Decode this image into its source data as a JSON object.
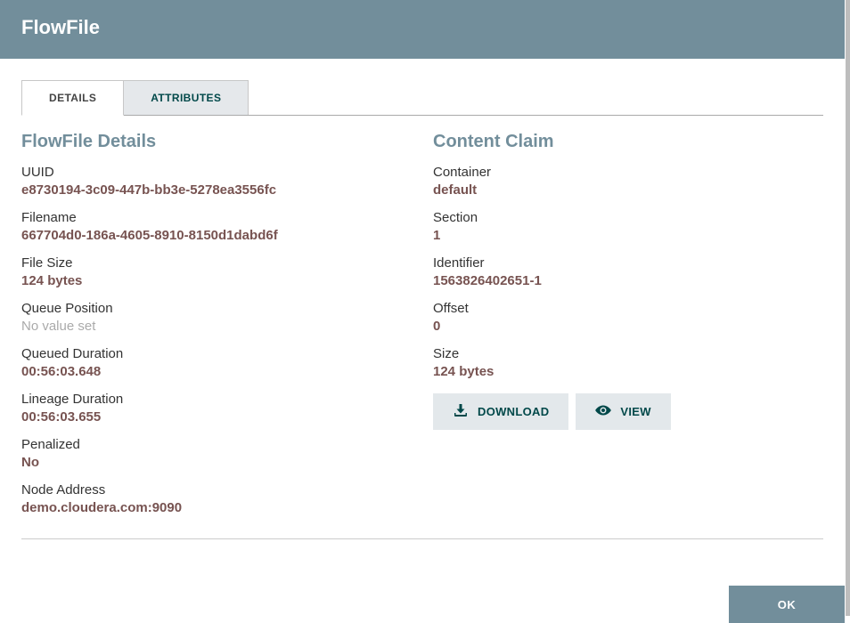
{
  "dialog": {
    "title": "FlowFile"
  },
  "tabs": {
    "details": "DETAILS",
    "attributes": "ATTRIBUTES"
  },
  "details": {
    "title": "FlowFile Details",
    "uuid": {
      "label": "UUID",
      "value": "e8730194-3c09-447b-bb3e-5278ea3556fc"
    },
    "filename": {
      "label": "Filename",
      "value": "667704d0-186a-4605-8910-8150d1dabd6f"
    },
    "fileSize": {
      "label": "File Size",
      "value": "124 bytes"
    },
    "queuePosition": {
      "label": "Queue Position",
      "value": "No value set"
    },
    "queuedDuration": {
      "label": "Queued Duration",
      "value": "00:56:03.648"
    },
    "lineageDuration": {
      "label": "Lineage Duration",
      "value": "00:56:03.655"
    },
    "penalized": {
      "label": "Penalized",
      "value": "No"
    },
    "nodeAddress": {
      "label": "Node Address",
      "value": "demo.cloudera.com:9090"
    }
  },
  "content": {
    "title": "Content Claim",
    "container": {
      "label": "Container",
      "value": "default"
    },
    "section": {
      "label": "Section",
      "value": "1"
    },
    "identifier": {
      "label": "Identifier",
      "value": "1563826402651-1"
    },
    "offset": {
      "label": "Offset",
      "value": "0"
    },
    "size": {
      "label": "Size",
      "value": "124 bytes"
    },
    "buttons": {
      "download": "DOWNLOAD",
      "view": "VIEW"
    }
  },
  "footer": {
    "ok": "OK"
  }
}
